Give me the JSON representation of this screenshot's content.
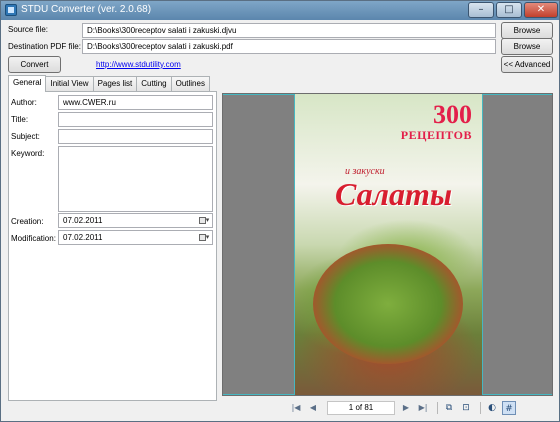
{
  "window": {
    "title": "STDU Converter (ver. 2.0.68)",
    "controls": {
      "minimize": "–",
      "maximize": "□",
      "close": "✕"
    }
  },
  "files": {
    "source_label": "Source file:",
    "source_value": "D:\\Books\\300receptov salati i zakuski.djvu",
    "destination_label": "Destination PDF file:",
    "destination_value": "D:\\Books\\300receptov salati i zakuski.pdf",
    "browse_label": "Browse"
  },
  "actions": {
    "convert_label": "Convert",
    "website_link": "http://www.stdutility.com",
    "advanced_label": "<< Advanced"
  },
  "tabs": [
    "General",
    "Initial View",
    "Pages list",
    "Cutting",
    "Outlines"
  ],
  "general": {
    "author_label": "Author:",
    "author_value": "www.CWER.ru",
    "title_label": "Title:",
    "title_value": "",
    "subject_label": "Subject:",
    "subject_value": "",
    "keyword_label": "Keyword:",
    "keyword_value": "",
    "creation_label": "Creation:",
    "creation_value": "07.02.2011",
    "modification_label": "Modification:",
    "modification_value": "07.02.2011"
  },
  "preview": {
    "cover_number": "300",
    "cover_word": "РЕЦЕПТОВ",
    "cover_subtitle": "и закуски",
    "cover_title": "Салаты"
  },
  "navigation": {
    "page_indicator": "1 of 81",
    "icons": [
      "first-page-icon",
      "prev-page-icon",
      "next-page-icon",
      "last-page-icon",
      "fit-width-icon",
      "fit-page-icon",
      "contrast-icon",
      "grid-icon"
    ]
  }
}
